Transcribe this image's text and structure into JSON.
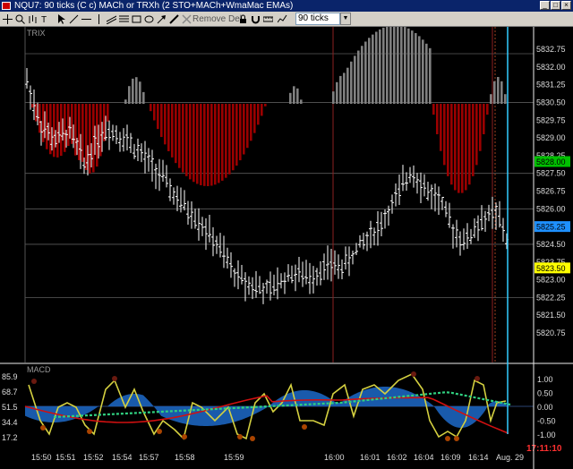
{
  "window": {
    "title": "NQU7: 90 ticks (C c) MACh or TRXh (2 STO+MACh+WmaMac EMAs)",
    "controls": [
      "_",
      "□",
      "×"
    ]
  },
  "toolbar": {
    "remove_label": "Remove Del",
    "interval_value": "90 ticks"
  },
  "price_panel": {
    "name": "TRIX",
    "y_ticks": [
      "5832.75",
      "5832.00",
      "5831.25",
      "5830.50",
      "5829.75",
      "5829.00",
      "5828.25",
      "5827.50",
      "5826.75",
      "5826.00",
      "5825.25",
      "5824.50",
      "5823.75",
      "5823.00",
      "5822.25",
      "5821.50",
      "5820.75"
    ],
    "tags": [
      {
        "label": "5828.00",
        "color": "#00c000"
      },
      {
        "label": "5825.25",
        "color": "#1e90ff"
      },
      {
        "label": "5823.50",
        "color": "#ffff00"
      }
    ]
  },
  "macd_panel": {
    "name": "MACD",
    "left_ticks": [
      "85.9",
      "68.7",
      "51.5",
      "34.4",
      "17.2"
    ],
    "right_ticks": [
      "1.00",
      "0.50",
      "0.00",
      "-0.50",
      "-1.00"
    ]
  },
  "x_axis": {
    "labels": [
      "15:50",
      "15:51",
      "15:52",
      "15:54",
      "15:57",
      "15:58",
      "15:59",
      "16:00",
      "16:01",
      "16:02",
      "16:04",
      "16:09",
      "16:14",
      "Aug. 29"
    ],
    "clock": "17:11:10"
  },
  "colors": {
    "hist_red": "#9b0000",
    "hist_grey": "#808080",
    "price_bars": "#ffffff",
    "macd_fill": "#1a5fb4",
    "stoch_yellow": "#d4d040",
    "line_red": "#d01010",
    "line_green": "#30d080",
    "cursor_blue": "#33ccff",
    "marker_dark_red": "#6a1a10",
    "marker_orange": "#aa4400"
  }
}
